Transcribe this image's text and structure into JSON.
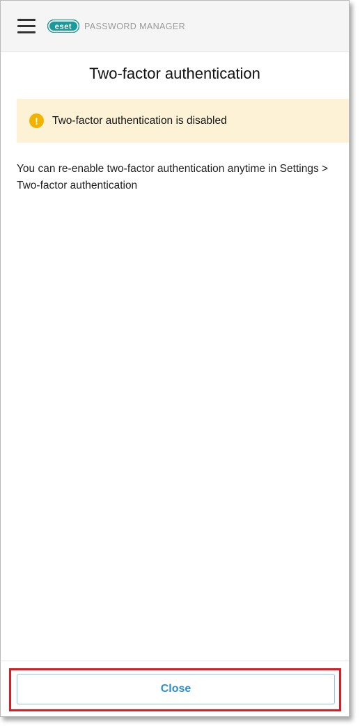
{
  "header": {
    "logo_text": "eset",
    "product_name": "PASSWORD MANAGER"
  },
  "page": {
    "title": "Two-factor authentication"
  },
  "banner": {
    "icon": "warning-icon",
    "icon_glyph": "!",
    "text": "Two-factor authentication is disabled",
    "color": "#fdf1d6",
    "icon_color": "#f2b300"
  },
  "body": {
    "text": "You can re-enable two-factor authentication anytime in Settings > Two-factor authentication"
  },
  "footer": {
    "close_label": "Close"
  },
  "colors": {
    "brand": "#1a9b9b",
    "accent": "#2b8fd6",
    "highlight": "#e8161d"
  }
}
